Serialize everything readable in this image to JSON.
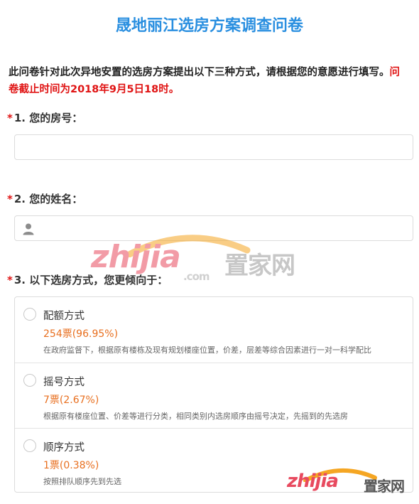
{
  "page": {
    "title": "晟地丽江选房方案调查问卷",
    "intro_text": "此问卷针对此次异地安置的选房方案提出以下三种方式，请根据您的意愿进行填写。",
    "deadline_text": "问卷截止时间为2018年9月5日18时。"
  },
  "questions": [
    {
      "required_mark": "*",
      "title": "1. 您的房号：",
      "value": ""
    },
    {
      "required_mark": "*",
      "title": "2. 您的姓名：",
      "value": "",
      "icon": "user-icon"
    },
    {
      "required_mark": "*",
      "title": "3. 以下选房方式，您更倾向于：",
      "options": [
        {
          "label": "配额方式",
          "votes": "254票(96.95%)",
          "description": "在政府监督下，根据原有楼栋及现有规划楼座位置，价差，层差等综合因素进行一对一科学配比"
        },
        {
          "label": "摇号方式",
          "votes": "7票(2.67%)",
          "description": "根据原有楼座位置、价差等进行分类，相同类别内选房顺序由摇号决定，先摇到的先选房"
        },
        {
          "label": "顺序方式",
          "votes": "1票(0.38%)",
          "description": "按照排队顺序先到先选"
        }
      ]
    }
  ],
  "watermark": {
    "brand": "zhijia",
    "cn": "置家网",
    "domain": ".com",
    "colors": {
      "brand_red": "#e84a5f",
      "brand_orange": "#f5a623",
      "cn_gray": "#9a9a9a"
    }
  }
}
